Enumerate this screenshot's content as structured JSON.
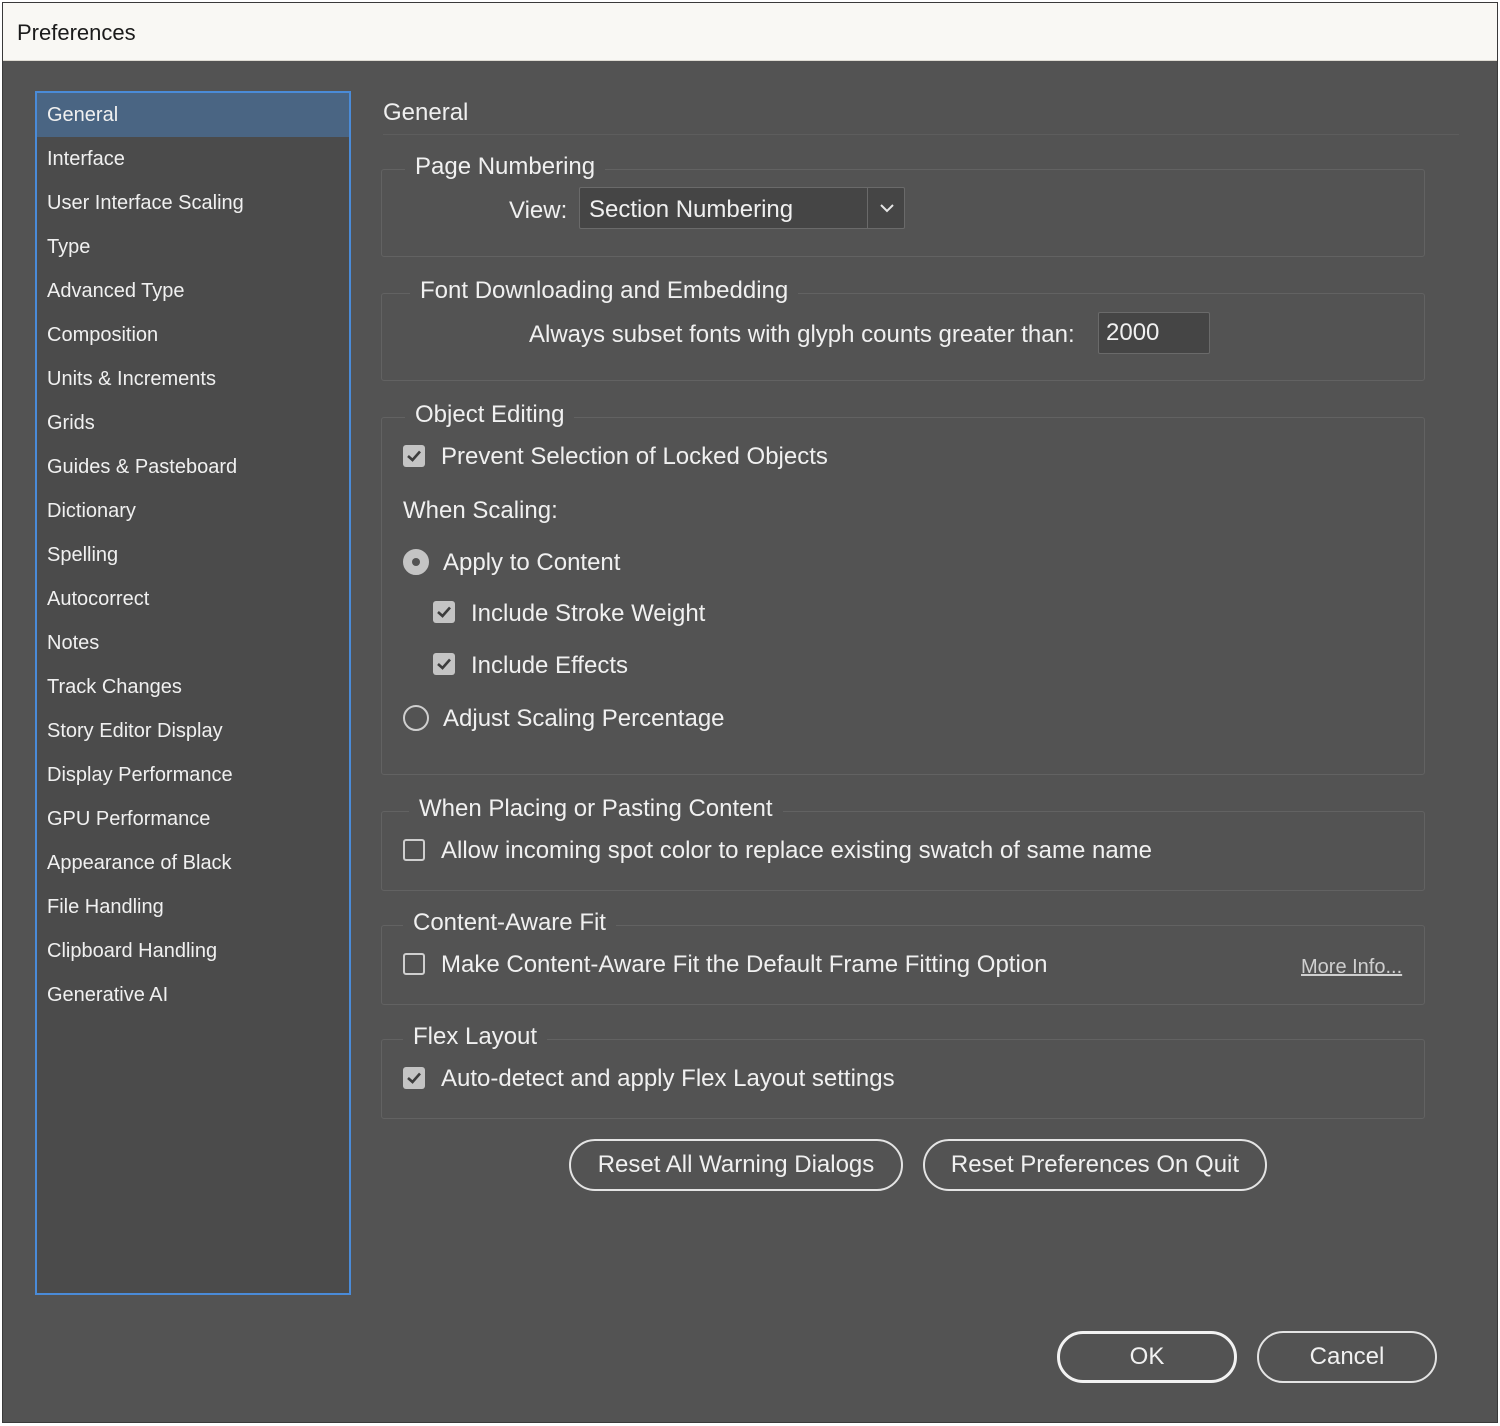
{
  "window": {
    "title": "Preferences"
  },
  "sidebar": {
    "selected": "General",
    "items": [
      "General",
      "Interface",
      "User Interface Scaling",
      "Type",
      "Advanced Type",
      "Composition",
      "Units & Increments",
      "Grids",
      "Guides & Pasteboard",
      "Dictionary",
      "Spelling",
      "Autocorrect",
      "Notes",
      "Track Changes",
      "Story Editor Display",
      "Display Performance",
      "GPU Performance",
      "Appearance of Black",
      "File Handling",
      "Clipboard Handling",
      "Generative AI"
    ]
  },
  "main": {
    "title": "General",
    "page_numbering": {
      "label": "Page Numbering",
      "view_label": "View:",
      "view_value": "Section Numbering"
    },
    "font_downloading": {
      "label": "Font Downloading and Embedding",
      "subset_label": "Always subset fonts with glyph counts greater than:",
      "subset_value": "2000"
    },
    "object_editing": {
      "label": "Object Editing",
      "prevent_selection": {
        "label": "Prevent Selection of Locked Objects",
        "checked": true
      },
      "when_scaling_label": "When Scaling:",
      "apply_to_content": {
        "label": "Apply to Content",
        "selected": true
      },
      "include_stroke_weight": {
        "label": "Include Stroke Weight",
        "checked": true
      },
      "include_effects": {
        "label": "Include Effects",
        "checked": true
      },
      "adjust_scaling": {
        "label": "Adjust Scaling Percentage",
        "selected": false
      }
    },
    "placing_pasting": {
      "label": "When Placing or Pasting Content",
      "allow_spot_color": {
        "label": "Allow incoming spot color to replace existing swatch of same name",
        "checked": false
      }
    },
    "content_aware_fit": {
      "label": "Content-Aware Fit",
      "make_default": {
        "label": "Make Content-Aware Fit the Default Frame Fitting Option",
        "checked": false
      },
      "more_info": "More Info..."
    },
    "flex_layout": {
      "label": "Flex Layout",
      "auto_detect": {
        "label": "Auto-detect and apply Flex Layout settings",
        "checked": true
      }
    },
    "reset_warning_label": "Reset All Warning Dialogs",
    "reset_prefs_label": "Reset Preferences On Quit"
  },
  "footer": {
    "ok_label": "OK",
    "cancel_label": "Cancel"
  },
  "icons": {
    "checkmark": "checkmark-icon",
    "chevron": "chevron-down-icon"
  },
  "colors": {
    "background": "#535353",
    "selection": "#4a6583",
    "focus_border": "#4a8bd8"
  }
}
